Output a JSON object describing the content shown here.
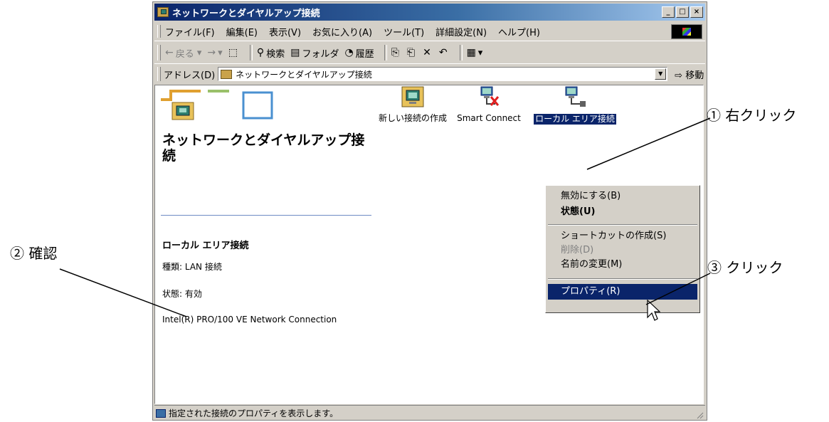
{
  "window": {
    "title": "ネットワークとダイヤルアップ接続",
    "controls": {
      "minimize": "_",
      "maximize": "□",
      "close": "×"
    }
  },
  "menu": [
    "ファイル(F)",
    "編集(E)",
    "表示(V)",
    "お気に入り(A)",
    "ツール(T)",
    "詳細設定(N)",
    "ヘルプ(H)"
  ],
  "toolbar": {
    "back": "戻る",
    "search": "検索",
    "folders": "フォルダ",
    "history": "履歴"
  },
  "address": {
    "label": "アドレス(D)",
    "value": "ネットワークとダイヤルアップ接続",
    "go": "移動"
  },
  "left_pane": {
    "title": "ネットワークとダイヤルアップ接続",
    "selected_name": "ローカル エリア接続",
    "type_line": "種類: LAN 接続",
    "status_line": "状態: 有効",
    "device_line": "Intel(R) PRO/100 VE Network Connection"
  },
  "connections": [
    {
      "label": "新しい接続の作成"
    },
    {
      "label": "Smart Connect"
    },
    {
      "label": "ローカル エリア接続"
    }
  ],
  "context_menu": {
    "disable": "無効にする(B)",
    "status": "状態(U)",
    "shortcut": "ショートカットの作成(S)",
    "delete": "削除(D)",
    "rename": "名前の変更(M)",
    "properties": "プロパティ(R)"
  },
  "statusbar": {
    "text": "指定された接続のプロパティを表示します。"
  },
  "annotations": {
    "step1": "① 右クリック",
    "step2": "② 確認",
    "step3": "③ クリック"
  },
  "colors": {
    "title_bar": "#0a246a",
    "highlight": "#0a246a",
    "face": "#d4d0c8"
  }
}
